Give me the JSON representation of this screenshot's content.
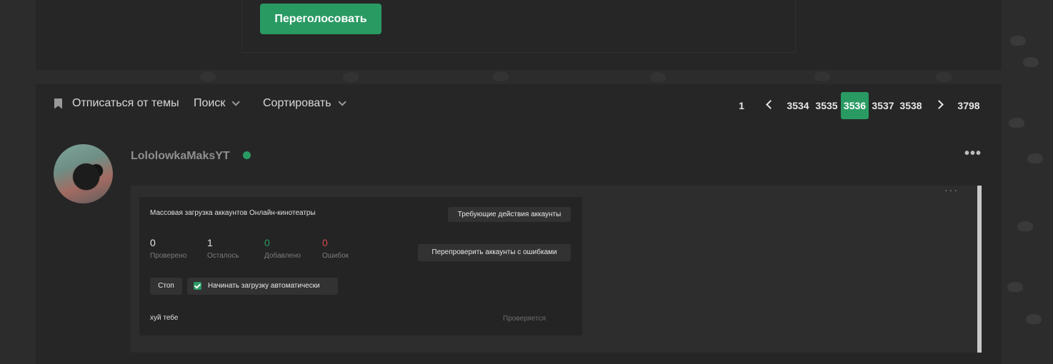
{
  "poll": {
    "revote_label": "Переголосовать"
  },
  "toolbar": {
    "unsubscribe_label": "Отписаться от темы",
    "search_label": "Поиск",
    "sort_label": "Сортировать"
  },
  "pagination": {
    "first": "1",
    "pages": [
      "3534",
      "3535",
      "3536",
      "3537",
      "3538"
    ],
    "current": "3536",
    "last": "3798"
  },
  "post": {
    "username": "LololowkaMaksYT",
    "online": true,
    "more_label": "•••",
    "inner_more_label": "···"
  },
  "widget": {
    "title": "Массовая загрузка аккаунтов Онлайн-кинотеатры",
    "action_required_button": "Требующие действия аккаунты",
    "recheck_button": "Перепроверить аккаунты с ошибками",
    "stats": [
      {
        "value": "0",
        "label": "Проверено",
        "tone": "normal"
      },
      {
        "value": "1",
        "label": "Осталось",
        "tone": "normal"
      },
      {
        "value": "0",
        "label": "Добавлено",
        "tone": "green"
      },
      {
        "value": "0",
        "label": "Ошибок",
        "tone": "red"
      }
    ],
    "stop_button": "Стоп",
    "auto_start_label": "Начинать загрузку автоматически",
    "auto_start_checked": true,
    "row": {
      "name": "хуй тебе",
      "status": "Проверяется"
    }
  },
  "colors": {
    "accent": "#2a9a63",
    "error": "#d34a4a",
    "panel": "#262626"
  }
}
